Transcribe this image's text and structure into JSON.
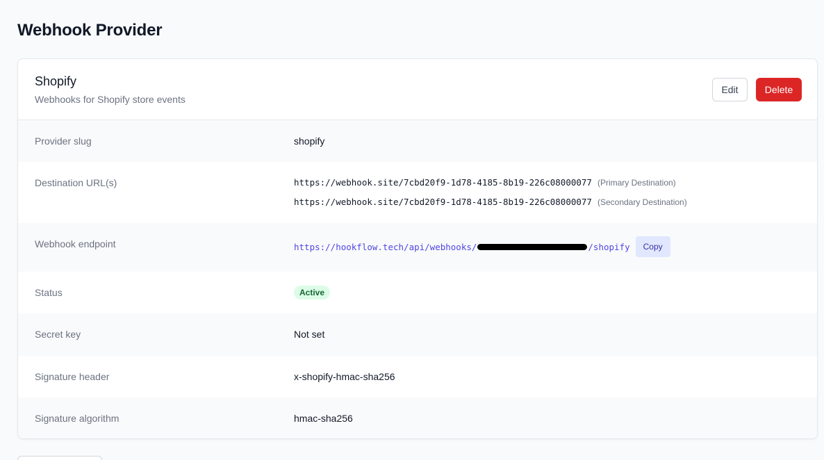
{
  "page": {
    "title": "Webhook Provider"
  },
  "provider": {
    "name": "Shopify",
    "description": "Webhooks for Shopify store events"
  },
  "actions": {
    "edit_label": "Edit",
    "delete_label": "Delete"
  },
  "details": {
    "slug": {
      "label": "Provider slug",
      "value": "shopify"
    },
    "destinations": {
      "label": "Destination URL(s)",
      "items": [
        {
          "url": "https://webhook.site/7cbd20f9-1d78-4185-8b19-226c08000077",
          "note": "(Primary Destination)"
        },
        {
          "url": "https://webhook.site/7cbd20f9-1d78-4185-8b19-226c08000077",
          "note": "(Secondary Destination)"
        }
      ]
    },
    "endpoint": {
      "label": "Webhook endpoint",
      "prefix": "https://hookflow.tech/api/webhooks/",
      "suffix": "/shopify",
      "copy_label": "Copy"
    },
    "status": {
      "label": "Status",
      "value": "Active"
    },
    "secret": {
      "label": "Secret key",
      "value": "Not set"
    },
    "signature_header": {
      "label": "Signature header",
      "value": "x-shopify-hmac-sha256"
    },
    "signature_algorithm": {
      "label": "Signature algorithm",
      "value": "hmac-sha256"
    }
  },
  "colors": {
    "delete": "#dc2626",
    "link": "#4f46e5",
    "badge_bg": "#dcfce7",
    "badge_text": "#166534"
  }
}
